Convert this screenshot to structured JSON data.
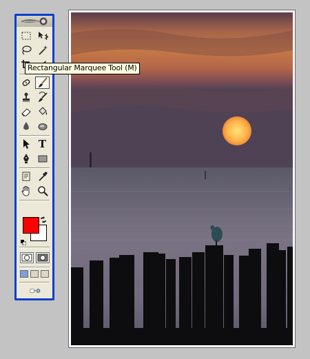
{
  "tooltip": {
    "text": "Rectangular Marquee Tool (M)"
  },
  "toolbox": {
    "header_icon": "adobe-feather-logo",
    "tools": [
      {
        "id": "rectangular-marquee",
        "icon": "marquee-icon",
        "selected": false
      },
      {
        "id": "move",
        "icon": "move-icon",
        "selected": false
      },
      {
        "id": "lasso",
        "icon": "lasso-icon",
        "selected": false
      },
      {
        "id": "magic-wand",
        "icon": "magic-wand-icon",
        "selected": false
      },
      {
        "id": "crop",
        "icon": "crop-icon",
        "selected": false
      },
      {
        "id": "slice",
        "icon": "slice-icon",
        "selected": false
      },
      {
        "id": "healing-brush",
        "icon": "healing-brush-icon",
        "selected": false
      },
      {
        "id": "brush",
        "icon": "brush-icon",
        "selected": true
      },
      {
        "id": "clone-stamp",
        "icon": "clone-stamp-icon",
        "selected": false
      },
      {
        "id": "history-brush",
        "icon": "history-brush-icon",
        "selected": false
      },
      {
        "id": "eraser",
        "icon": "eraser-icon",
        "selected": false
      },
      {
        "id": "paint-bucket",
        "icon": "paint-bucket-icon",
        "selected": false
      },
      {
        "id": "blur",
        "icon": "blur-icon",
        "selected": false
      },
      {
        "id": "dodge",
        "icon": "dodge-icon",
        "selected": false
      },
      {
        "id": "path-selection",
        "icon": "path-selection-icon",
        "selected": false
      },
      {
        "id": "type",
        "icon": "type-icon",
        "label": "T",
        "selected": false
      },
      {
        "id": "pen",
        "icon": "pen-icon",
        "selected": false
      },
      {
        "id": "rectangle-shape",
        "icon": "rectangle-shape-icon",
        "selected": false
      },
      {
        "id": "notes",
        "icon": "notes-icon",
        "selected": false
      },
      {
        "id": "eyedropper",
        "icon": "eyedropper-icon",
        "selected": false
      },
      {
        "id": "hand",
        "icon": "hand-icon",
        "selected": false
      },
      {
        "id": "zoom",
        "icon": "zoom-icon",
        "selected": false
      }
    ],
    "colors": {
      "foreground": "#ff0000",
      "background": "#ffffff"
    },
    "modes": [
      "standard-mode",
      "quick-mask-mode"
    ],
    "screen_modes": [
      "standard-screen",
      "full-screen-menu",
      "full-screen"
    ],
    "jump_to": "imageready-jump-icon"
  },
  "document": {
    "image": "sunset-over-sea-with-wooden-posts-and-heron"
  }
}
